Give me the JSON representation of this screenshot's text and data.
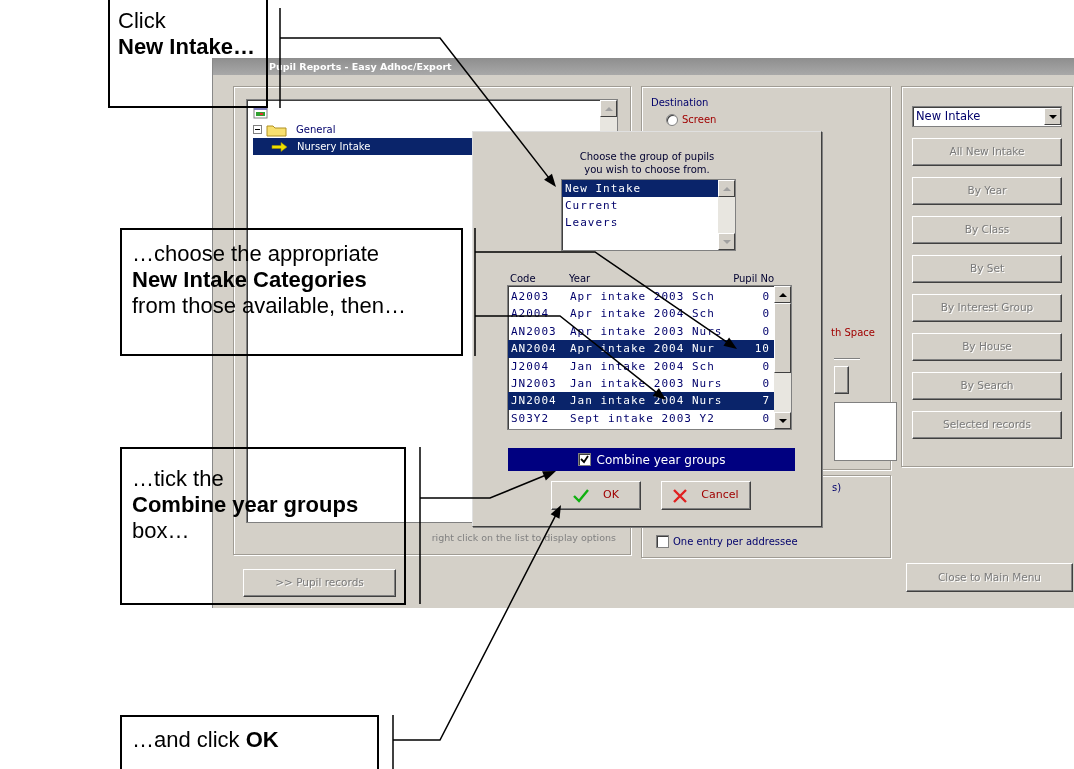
{
  "window": {
    "title": "Pupil Reports - Easy Adhoc/Export"
  },
  "tree": {
    "items": [
      {
        "label": "General",
        "expanded": true,
        "children": [
          {
            "label": "Nursery Intake",
            "selected": true
          }
        ]
      }
    ],
    "hint": "right click on the list to display options"
  },
  "pupil_records_button": {
    "label": ">> Pupil records",
    "disabled": true
  },
  "destination": {
    "title": "Destination",
    "options": [
      {
        "label": "Screen",
        "selected": false
      }
    ],
    "partial_text": "th Space"
  },
  "output_options": {
    "partial_text": "s)",
    "checkboxes": [
      {
        "label": "One entry per addressee",
        "checked": false
      }
    ]
  },
  "group_select": {
    "value": "New Intake"
  },
  "group_buttons": [
    {
      "label": "All New Intake",
      "disabled": true
    },
    {
      "label": "By Year",
      "disabled": true
    },
    {
      "label": "By Class",
      "disabled": true
    },
    {
      "label": "By Set",
      "disabled": true
    },
    {
      "label": "By Interest Group",
      "disabled": true
    },
    {
      "label": "By House",
      "disabled": true
    },
    {
      "label": "By Search",
      "disabled": true
    },
    {
      "label": "Selected records",
      "disabled": true
    }
  ],
  "close_button": {
    "label": "Close to Main Menu",
    "disabled": true
  },
  "dialog": {
    "prompt": "Choose the group of pupils\nyou wish to choose from.",
    "groups": [
      {
        "label": "New Intake",
        "selected": true
      },
      {
        "label": "Current",
        "selected": false
      },
      {
        "label": "Leavers",
        "selected": false
      }
    ],
    "columns": [
      "Code",
      "Year",
      "Pupil No"
    ],
    "rows": [
      {
        "code": "A2003",
        "year": "Apr intake 2003 Sch",
        "pupil_no": "0",
        "selected": false
      },
      {
        "code": "A2004",
        "year": "Apr intake 2004 Sch",
        "pupil_no": "0",
        "selected": false
      },
      {
        "code": "AN2003",
        "year": "Apr intake 2003 Nurs",
        "pupil_no": "0",
        "selected": false
      },
      {
        "code": "AN2004",
        "year": "Apr intake 2004 Nur",
        "pupil_no": "10",
        "selected": true
      },
      {
        "code": "J2004",
        "year": "Jan intake 2004 Sch",
        "pupil_no": "0",
        "selected": false
      },
      {
        "code": "JN2003",
        "year": "Jan intake 2003 Nurs",
        "pupil_no": "0",
        "selected": false
      },
      {
        "code": "JN2004",
        "year": "Jan intake 2004 Nurs",
        "pupil_no": "7",
        "selected": true
      },
      {
        "code": "S03Y2",
        "year": "Sept intake 2003 Y2",
        "pupil_no": "0",
        "selected": false
      }
    ],
    "combine": {
      "label": "Combine year groups",
      "checked": true
    },
    "buttons": [
      {
        "label": "OK",
        "kind": "ok"
      },
      {
        "label": "Cancel",
        "kind": "cancel"
      }
    ]
  },
  "callouts": [
    {
      "text": "Click\n**New Intake…**"
    },
    {
      "text": "…choose the appropriate\n**New Intake Categories**\nfrom those available, then…"
    },
    {
      "text": "…tick the\n**Combine year groups**\nbox…"
    },
    {
      "text": "…and click **OK**"
    }
  ]
}
